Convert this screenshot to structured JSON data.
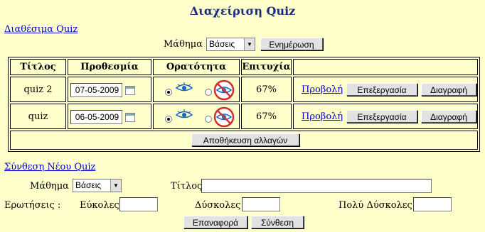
{
  "header": {
    "title": "Διαχείριση Quiz"
  },
  "available": {
    "link": "Διαθέσιμα Quiz",
    "subject_label": "Μάθημα",
    "subject_value": "Βάσεις",
    "update_button": "Ενημέρωση"
  },
  "table": {
    "columns": [
      "Τίτλος",
      "Προθεσμία",
      "Ορατότητα",
      "Επιτυχία",
      ""
    ],
    "rows": [
      {
        "title": "quiz 2",
        "deadline": "07-05-2009",
        "visible": true,
        "success": "67%",
        "view": "Προβολή",
        "edit": "Επεξεργασία",
        "delete": "Διαγραφή"
      },
      {
        "title": "quiz",
        "deadline": "06-05-2009",
        "visible": true,
        "success": "67%",
        "view": "Προβολή",
        "edit": "Επεξεργασία",
        "delete": "Διαγραφή"
      }
    ],
    "save_button": "Αποθήκευση αλλαγών"
  },
  "new_quiz": {
    "link": "Σύνθεση Νέου Quiz",
    "subject_label": "Μάθημα",
    "subject_value": "Βάσεις",
    "title_label": "Τίτλος",
    "title_value": "",
    "questions_label": "Ερωτήσεις :",
    "easy_label": "Εύκολες",
    "hard_label": "Δύσκολες",
    "very_hard_label": "Πολύ Δύσκολες",
    "reset_button": "Επαναφορά",
    "compose_button": "Σύνθεση"
  },
  "colors": {
    "background": "#ffffcc",
    "title": "#1a2b80",
    "link": "#0000cc"
  },
  "icons": [
    "calendar-icon",
    "eye-visible-icon",
    "eye-hidden-icon"
  ]
}
